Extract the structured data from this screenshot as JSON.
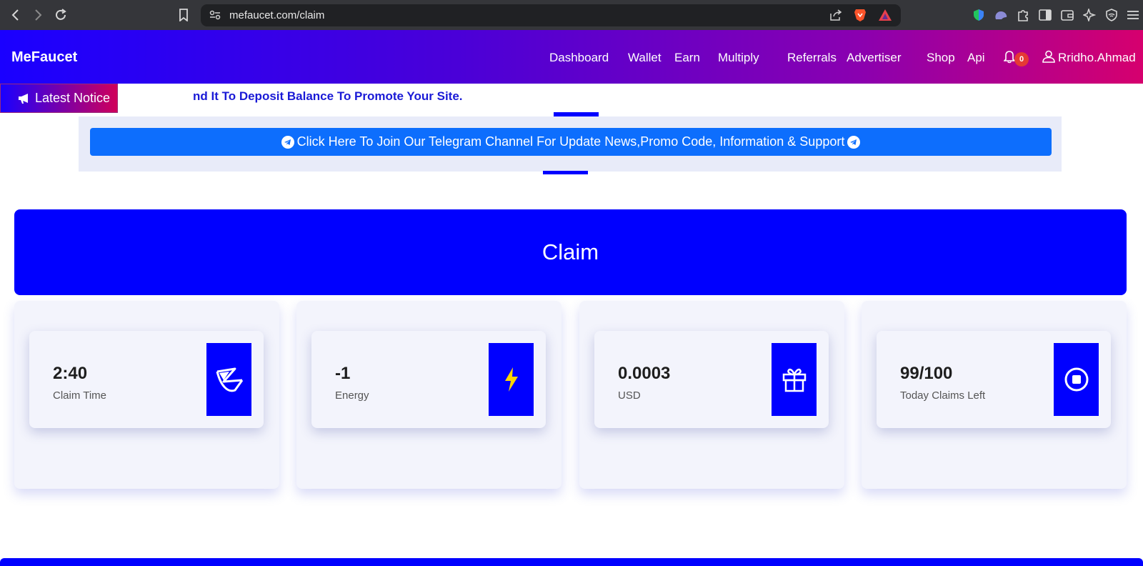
{
  "browser": {
    "url": "mefaucet.com/claim"
  },
  "header": {
    "logo": "MeFaucet",
    "nav": [
      "Dashboard",
      "Wallet",
      "Earn",
      "Multiply",
      "Referrals",
      "Advertiser",
      "Shop",
      "Api"
    ],
    "notification_count": "0",
    "username": "Rridho.Ahmad"
  },
  "notice": {
    "button_label": "Latest Notice",
    "marquee": "nd It To Deposit Balance To Promote Your Site."
  },
  "telegram": {
    "label": "Click Here To Join Our Telegram Channel For Update News,Promo Code, Information & Support"
  },
  "claim": {
    "title": "Claim"
  },
  "stats": [
    {
      "value": "2:40",
      "label": "Claim Time",
      "icon": "hourglass-icon"
    },
    {
      "value": "-1",
      "label": "Energy",
      "icon": "lightning-icon"
    },
    {
      "value": "0.0003",
      "label": "USD",
      "icon": "gift-icon"
    },
    {
      "value": "99/100",
      "label": "Today Claims Left",
      "icon": "stop-circle-icon"
    }
  ],
  "colors": {
    "primary_blue": "#0000ff",
    "telegram_button": "#0d6efd",
    "header_gradient_start": "#1a00ff",
    "header_gradient_end": "#d6006e",
    "energy_icon": "#ffd600"
  }
}
